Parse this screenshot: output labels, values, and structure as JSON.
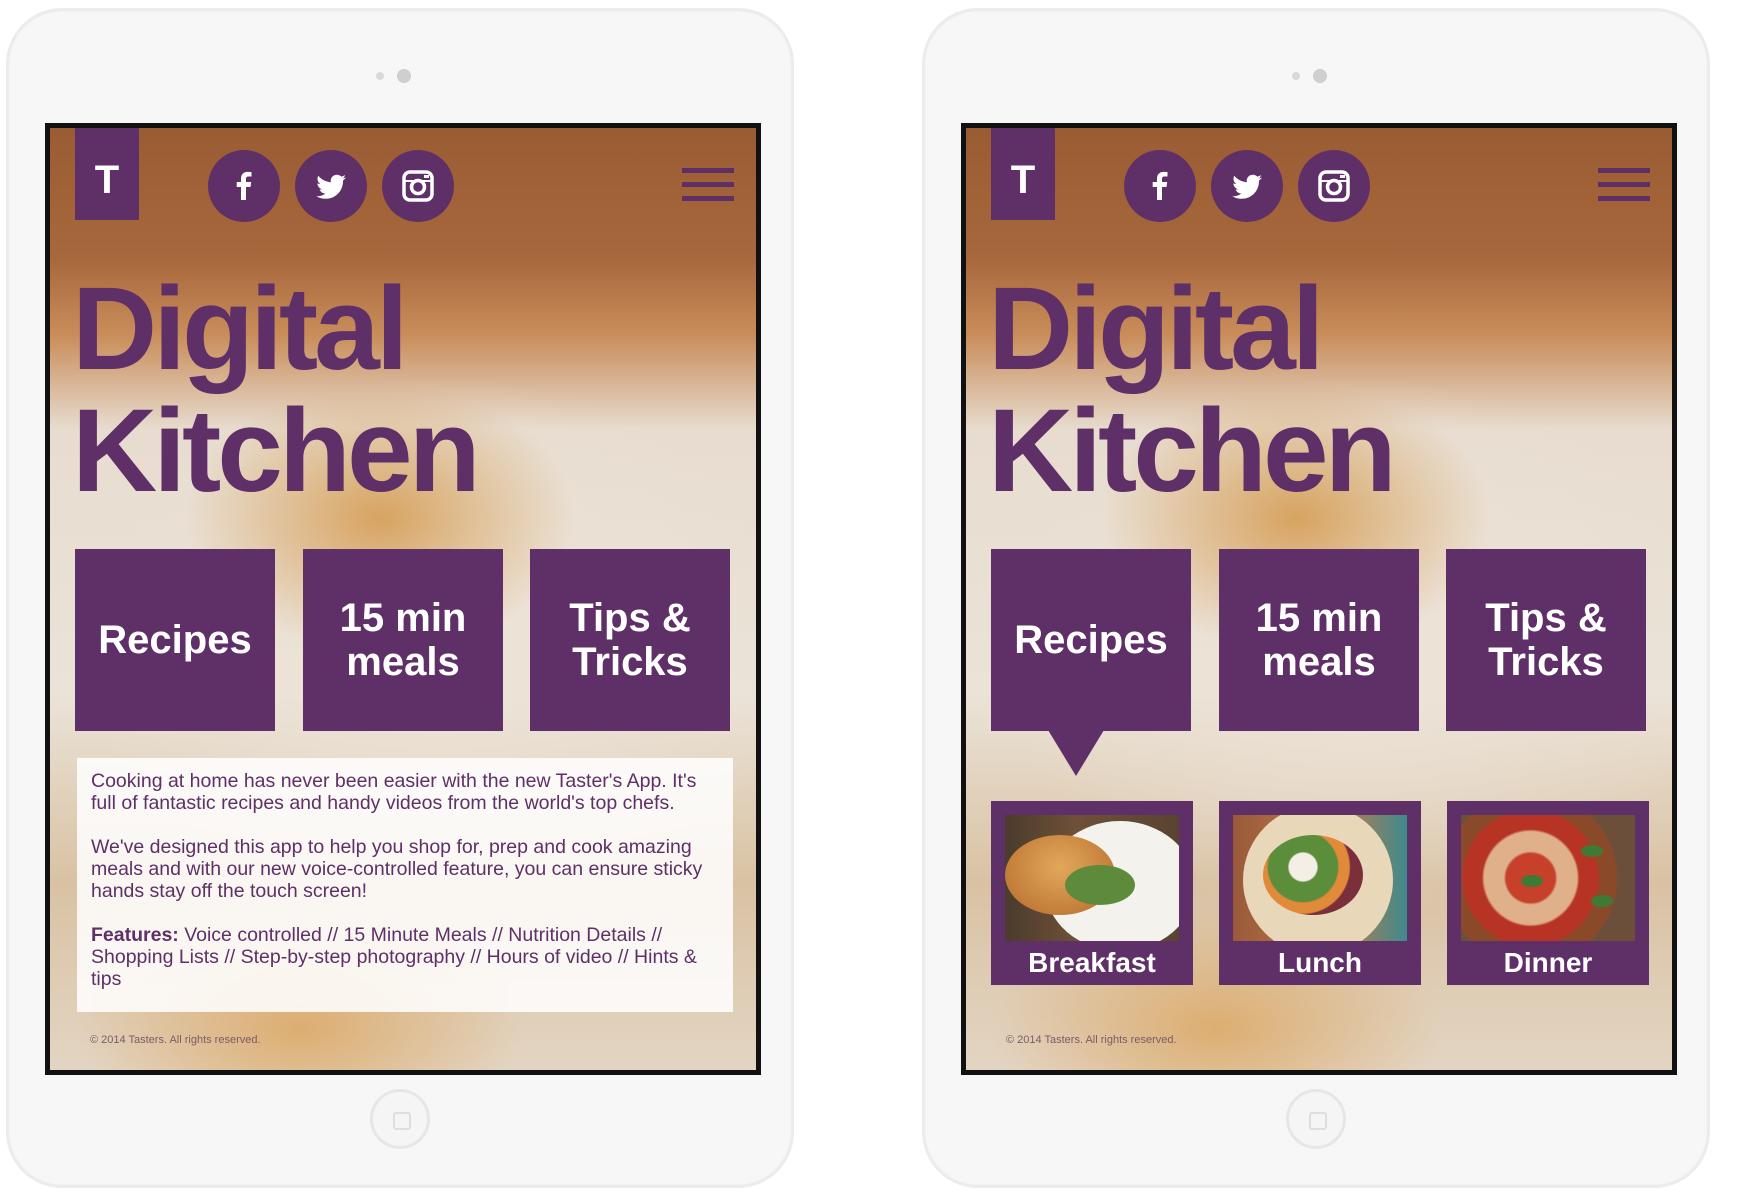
{
  "brand_letter": "T",
  "social": [
    {
      "name": "facebook-icon"
    },
    {
      "name": "twitter-icon"
    },
    {
      "name": "instagram-icon"
    }
  ],
  "title": {
    "line1": "Digital",
    "line2": "Kitchen"
  },
  "tiles": {
    "recipes": "Recipes",
    "meals_l1": "15 min",
    "meals_l2": "meals",
    "tips_l1": "Tips &",
    "tips_l2": "Tricks"
  },
  "intro": {
    "p1": "Cooking at home has never been easier with the new Taster's App. It's full of fantastic recipes and handy videos from the world's top chefs.",
    "p2": "We've designed this app to help you shop for, prep and cook amazing meals and with our new voice-controlled feature, you can ensure sticky hands stay off the touch screen!",
    "features_label": "Features:",
    "features_text": " Voice controlled // 15 Minute Meals //  Nutrition Details // Shopping Lists // Step-by-step photography // Hours of video // Hints & tips"
  },
  "meals": {
    "breakfast": "Breakfast",
    "lunch": "Lunch",
    "dinner": "Dinner"
  },
  "copyright": "© 2014 Tasters. All rights reserved.",
  "colors": {
    "accent": "#5f2f67",
    "device": "#f7f7f7",
    "screen_border": "#111111"
  }
}
